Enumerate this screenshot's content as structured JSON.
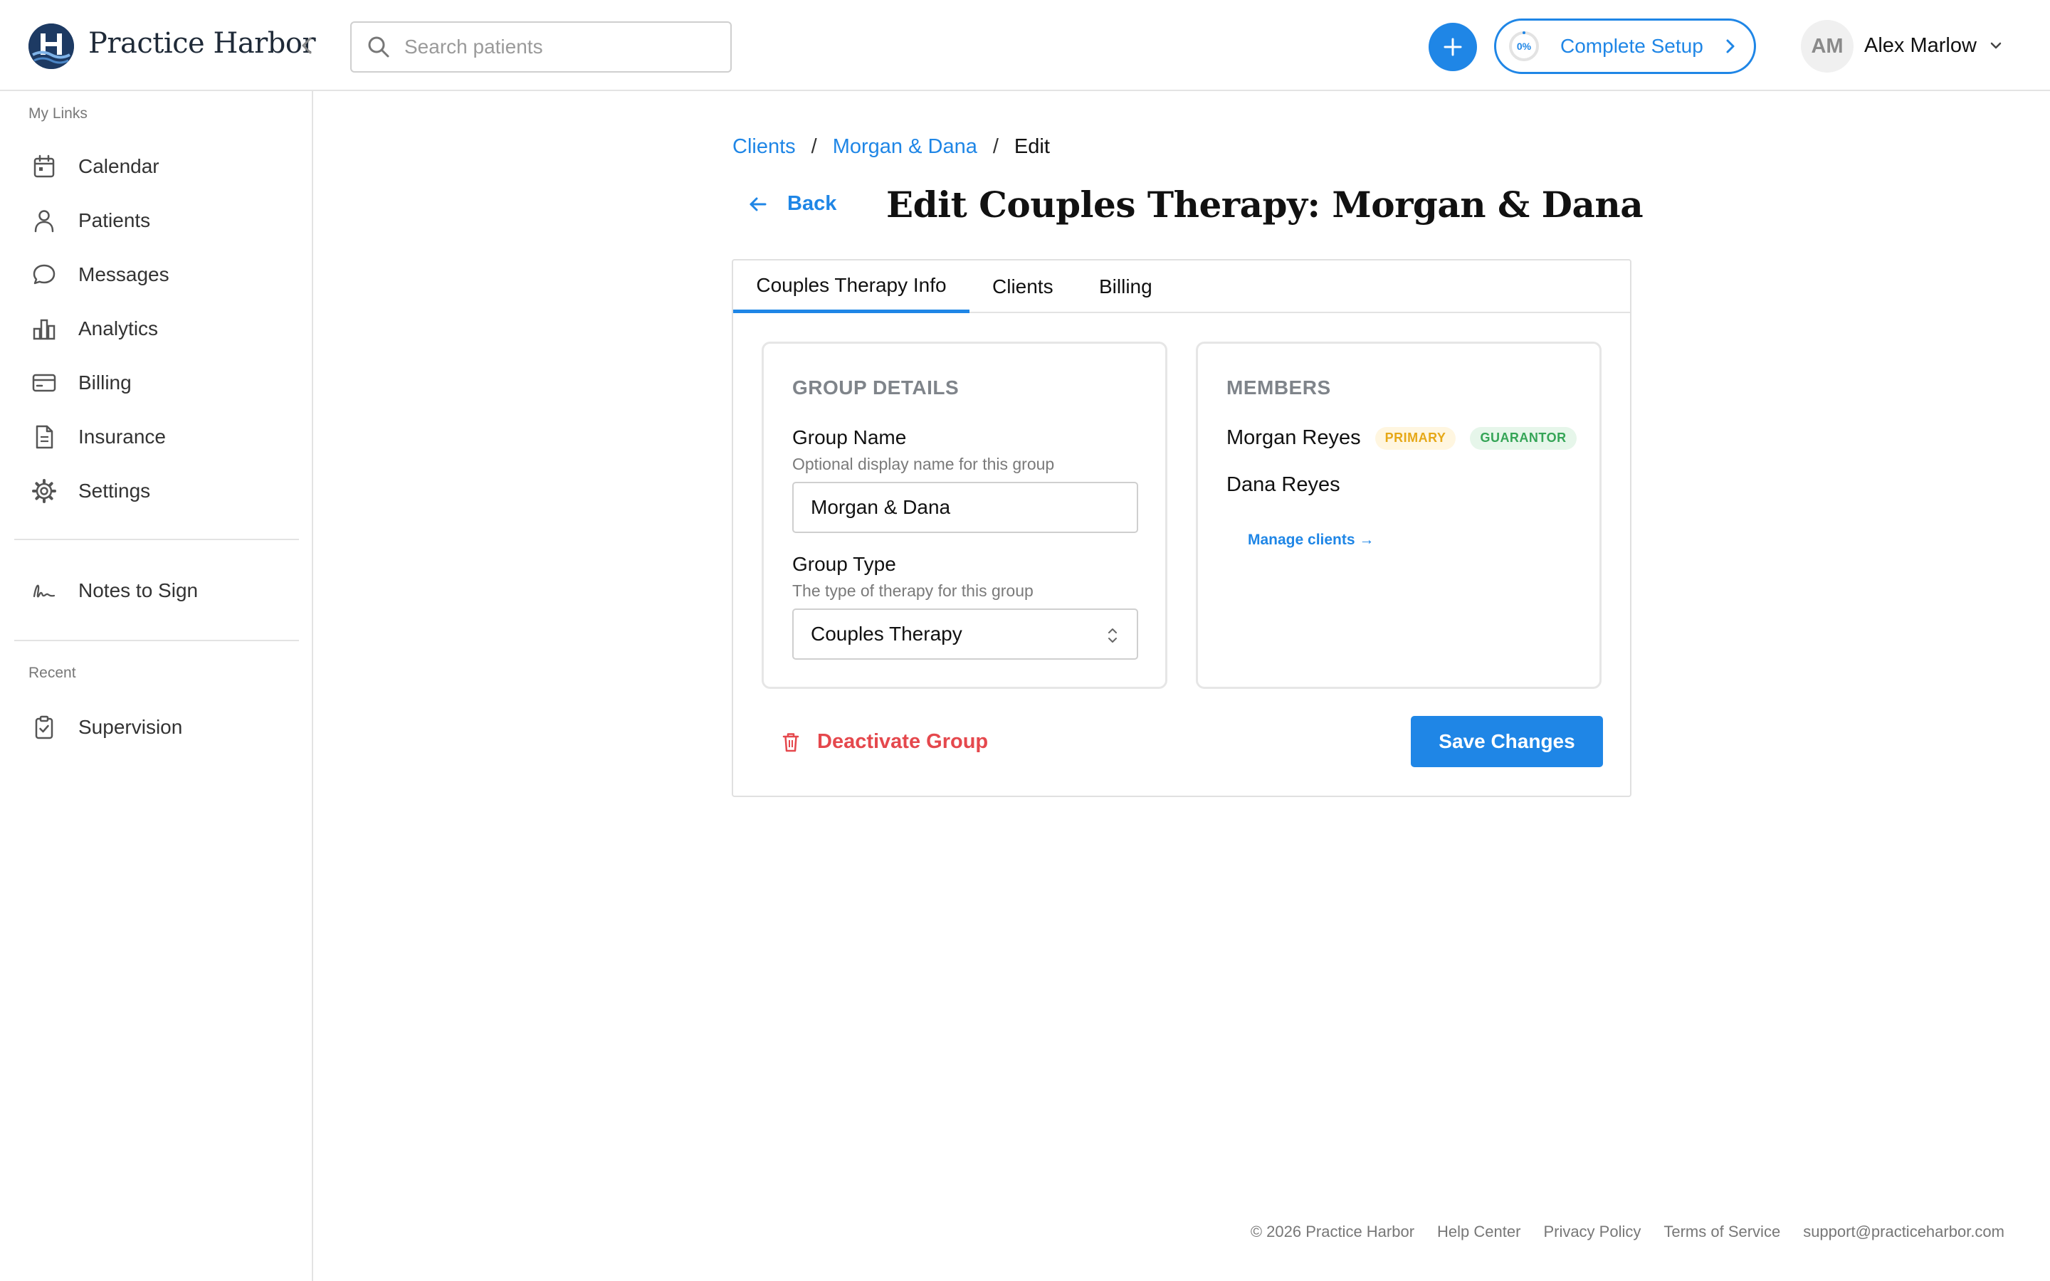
{
  "app": {
    "brand": "Practice Harbor",
    "logo_icon": "harbor-logo-icon",
    "accent_color": "#1f86e6",
    "danger_color": "#e5484d"
  },
  "header": {
    "search_placeholder": "Search patients",
    "setup": {
      "progress_label": "0%",
      "progress": 0,
      "label": "Complete Setup"
    },
    "user": {
      "initials": "AM",
      "name": "Alex Marlow"
    }
  },
  "sidebar": {
    "my_links_label": "My Links",
    "items": [
      {
        "label": "Calendar",
        "icon": "calendar-icon"
      },
      {
        "label": "Patients",
        "icon": "user-icon"
      },
      {
        "label": "Messages",
        "icon": "chat-bubble-icon"
      },
      {
        "label": "Analytics",
        "icon": "bar-chart-icon"
      },
      {
        "label": "Billing",
        "icon": "credit-card-icon"
      },
      {
        "label": "Insurance",
        "icon": "document-icon"
      },
      {
        "label": "Settings",
        "icon": "gear-icon"
      }
    ],
    "notes_to_sign": {
      "label": "Notes to Sign",
      "icon": "signature-icon"
    },
    "recent_label": "Recent",
    "recent_items": [
      {
        "label": "Supervision",
        "icon": "clipboard-check-icon"
      }
    ]
  },
  "breadcrumb": {
    "items": [
      "Clients",
      "Morgan & Dana"
    ],
    "separator": "/",
    "current": "Edit"
  },
  "page": {
    "back_label": "Back",
    "title": "Edit Couples Therapy: Morgan & Dana"
  },
  "tabs": [
    "Couples Therapy Info",
    "Clients",
    "Billing"
  ],
  "active_tab": "Couples Therapy Info",
  "group_details": {
    "heading": "GROUP DETAILS",
    "name_label": "Group Name",
    "name_help": "Optional display name for this group",
    "name_value": "Morgan & Dana",
    "type_label": "Group Type",
    "type_help": "The type of therapy for this group",
    "type_value": "Couples Therapy"
  },
  "members": {
    "heading": "MEMBERS",
    "list": [
      {
        "name": "Morgan Reyes",
        "badges": [
          "PRIMARY",
          "GUARANTOR"
        ]
      },
      {
        "name": "Dana Reyes",
        "badges": []
      }
    ],
    "manage_link": "Manage clients →"
  },
  "actions": {
    "deactivate": "Deactivate Group",
    "save": "Save Changes"
  },
  "footer": {
    "copyright": "© 2026 Practice Harbor",
    "links": [
      "Help Center",
      "Privacy Policy",
      "Terms of Service",
      "support@practiceharbor.com"
    ]
  }
}
